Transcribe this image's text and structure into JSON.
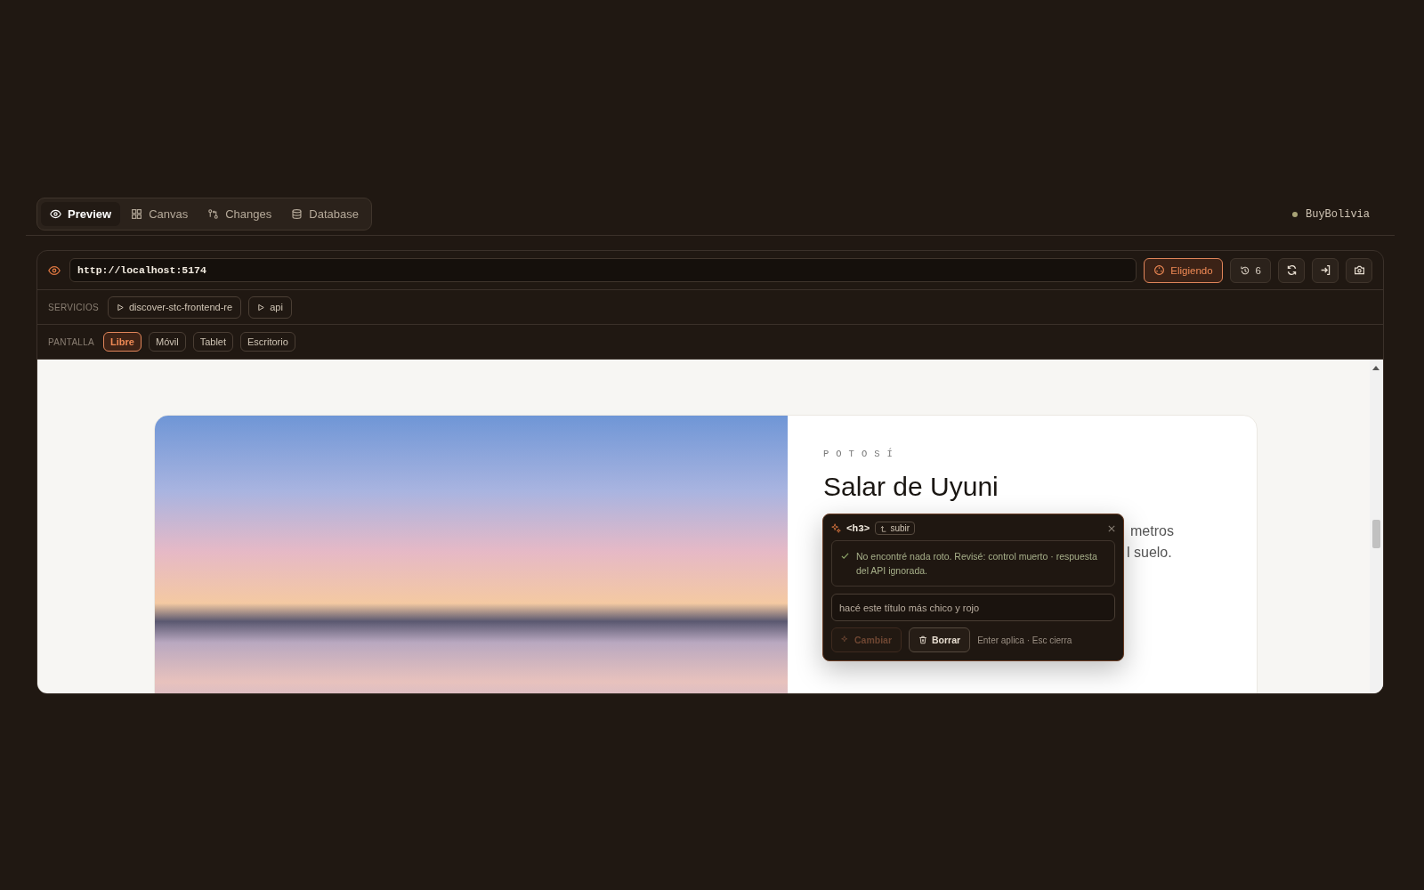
{
  "tabs": [
    {
      "label": "Preview",
      "selected": true
    },
    {
      "label": "Canvas",
      "selected": false
    },
    {
      "label": "Changes",
      "selected": false
    },
    {
      "label": "Database",
      "selected": false
    }
  ],
  "project": {
    "name": "BuyBolivia"
  },
  "browser": {
    "url": "http://localhost:5174",
    "pick_button": {
      "label": "Eligiendo",
      "active": true
    },
    "history_button": {
      "count": "6"
    }
  },
  "services": {
    "label": "SERVICIOS",
    "items": [
      "discover-stc-frontend-re",
      "api"
    ]
  },
  "screen": {
    "label": "PANTALLA",
    "options": [
      {
        "label": "Libre",
        "selected": true
      },
      {
        "label": "Móvil",
        "selected": false
      },
      {
        "label": "Tablet",
        "selected": false
      },
      {
        "label": "Escritorio",
        "selected": false
      }
    ]
  },
  "card": {
    "region": "POTOSÍ",
    "title": "Salar de Uyuni",
    "text_fragments": [
      "metros",
      "l suelo."
    ]
  },
  "inspector": {
    "tag": "<h3>",
    "up_button": "subir",
    "message": "No encontré nada roto. Revisé: control muerto · respuesta del API ignorada.",
    "prompt_value": "hacé este título más chico y rojo",
    "apply_button": {
      "label": "Cambiar",
      "disabled": true
    },
    "delete_button": "Borrar",
    "hint": "Enter aplica · Esc cierra"
  }
}
